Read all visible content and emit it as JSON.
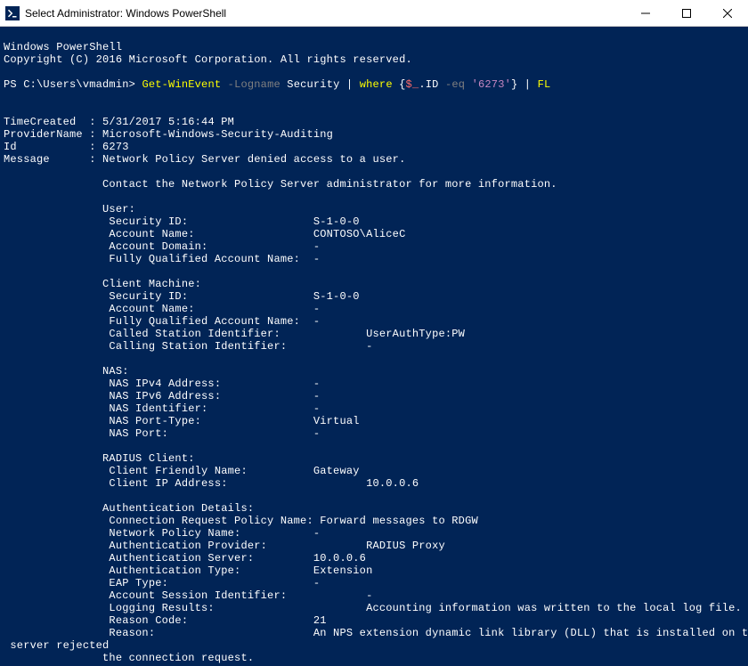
{
  "window": {
    "title": "Select Administrator: Windows PowerShell"
  },
  "header": {
    "line1": "Windows PowerShell",
    "line2": "Copyright (C) 2016 Microsoft Corporation. All rights reserved."
  },
  "prompt": {
    "path": "PS C:\\Users\\vmadmin> ",
    "cmd": "Get-WinEvent",
    "flag": " -Logname",
    "arg1": " Security | ",
    "cmd2": "where",
    "block_open": " {",
    "var": "$_",
    "prop": ".ID ",
    "op": "-eq",
    "str": " '6273'",
    "block_close": "} | ",
    "cmd3": "FL"
  },
  "output": {
    "timeCreated_label": "TimeCreated  : ",
    "timeCreated": "5/31/2017 5:16:44 PM",
    "providerName_label": "ProviderName : ",
    "providerName": "Microsoft-Windows-Security-Auditing",
    "id_label": "Id           : ",
    "id": "6273",
    "message_label": "Message      : ",
    "message": "Network Policy Server denied access to a user.",
    "contact": "               Contact the Network Policy Server administrator for more information.",
    "user_header": "               User:",
    "user_secid": "                Security ID:                   S-1-0-0",
    "user_acct": "                Account Name:                  CONTOSO\\AliceC",
    "user_domain": "                Account Domain:                -",
    "user_fqan": "                Fully Qualified Account Name:  -",
    "client_header": "               Client Machine:",
    "client_secid": "                Security ID:                   S-1-0-0",
    "client_acct": "                Account Name:                  -",
    "client_fqan": "                Fully Qualified Account Name:  -",
    "client_called": "                Called Station Identifier:             UserAuthType:PW",
    "client_calling": "                Calling Station Identifier:            -",
    "nas_header": "               NAS:",
    "nas_ipv4": "                NAS IPv4 Address:              -",
    "nas_ipv6": "                NAS IPv6 Address:              -",
    "nas_id": "                NAS Identifier:                -",
    "nas_porttype": "                NAS Port-Type:                 Virtual",
    "nas_port": "                NAS Port:                      -",
    "radius_header": "               RADIUS Client:",
    "radius_name": "                Client Friendly Name:          Gateway",
    "radius_ip": "                Client IP Address:                     10.0.0.6",
    "auth_header": "               Authentication Details:",
    "auth_crpn": "                Connection Request Policy Name: Forward messages to RDGW",
    "auth_npn": "                Network Policy Name:           -",
    "auth_provider": "                Authentication Provider:               RADIUS Proxy",
    "auth_server": "                Authentication Server:         10.0.0.6",
    "auth_type": "                Authentication Type:           Extension",
    "auth_eap": "                EAP Type:                      -",
    "auth_sessid": "                Account Session Identifier:            -",
    "auth_logging": "                Logging Results:                       Accounting information was written to the local log file.",
    "auth_code": "                Reason Code:                   21",
    "auth_reason": "                Reason:                        An NPS extension dynamic link library (DLL) that is installed on the NPS",
    "auth_reason2": " server rejected",
    "auth_reason3": "               the connection request."
  }
}
